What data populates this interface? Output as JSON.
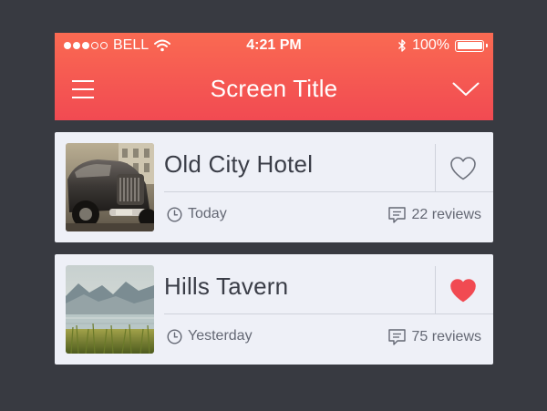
{
  "status_bar": {
    "signal_bars_filled": 3,
    "signal_bars_total": 5,
    "carrier": "BELL",
    "time": "4:21 PM",
    "battery": "100%"
  },
  "navbar": {
    "title": "Screen Title"
  },
  "colors": {
    "header_top": "#fa6a52",
    "header_bottom": "#f14a52",
    "favorite_active": "#f14a52",
    "background": "#383a41",
    "card": "#eef0f7"
  },
  "listings": [
    {
      "title": "Old City Hotel",
      "date": "Today",
      "reviews": "22 reviews",
      "favorited": false,
      "image": "vintage-car-photo"
    },
    {
      "title": "Hills Tavern",
      "date": "Yesterday",
      "reviews": "75 reviews",
      "favorited": true,
      "image": "lake-mountains-photo"
    }
  ]
}
